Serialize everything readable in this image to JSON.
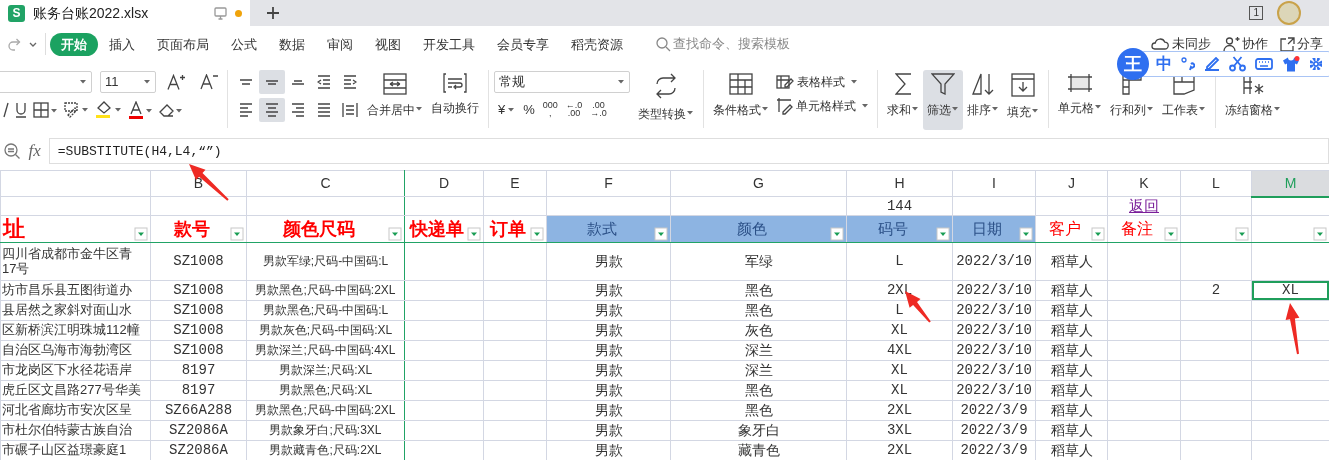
{
  "document_tab": {
    "app_letter": "S",
    "title": "账务台账2022.xlsx",
    "unsaved": true
  },
  "window_count": "1",
  "menu_tabs": [
    {
      "label": "开始",
      "selected": true
    },
    {
      "label": "插入",
      "selected": false
    },
    {
      "label": "页面布局",
      "selected": false
    },
    {
      "label": "公式",
      "selected": false
    },
    {
      "label": "数据",
      "selected": false
    },
    {
      "label": "审阅",
      "selected": false
    },
    {
      "label": "视图",
      "selected": false
    },
    {
      "label": "开发工具",
      "selected": false
    },
    {
      "label": "会员专享",
      "selected": false
    },
    {
      "label": "稻壳资源",
      "selected": false
    }
  ],
  "search": {
    "placeholder": "查找命令、搜索模板"
  },
  "account_actions": [
    "未同步",
    "协作",
    "分享"
  ],
  "ime_toolbar": {
    "logo": "王",
    "mode": "中"
  },
  "ribbon": {
    "font_size": "11",
    "align_buttons": [
      {
        "selected": false
      },
      {
        "selected": true
      },
      {
        "selected": false
      },
      {
        "selected": false
      },
      {
        "selected": false
      },
      {
        "selected": false
      },
      {
        "selected": true
      },
      {
        "selected": false
      },
      {
        "selected": false
      },
      {
        "selected": false
      }
    ],
    "number_format": "常规",
    "number_buttons": [
      {
        "label": "¥",
        "dropdown": true
      },
      {
        "label": "%",
        "dropdown": false
      },
      {
        "label": "000\n,",
        "dropdown": false
      },
      {
        "label": "←.0\n.00",
        "dropdown": false
      },
      {
        "label": ".00\n→.0",
        "dropdown": false
      }
    ],
    "buttons": [
      {
        "label": "合并居中",
        "dropdown": true,
        "selected": false
      },
      {
        "label": "自动换行",
        "dropdown": false,
        "selected": false
      },
      {
        "label": "类型转换",
        "dropdown": true,
        "selected": false
      },
      {
        "label": "条件格式",
        "dropdown": true,
        "selected": false
      },
      {
        "label": "表格样式",
        "dropdown": true,
        "selected": false
      },
      {
        "label": "单元格样式",
        "dropdown": true,
        "selected": false
      },
      {
        "label": "求和",
        "dropdown": true,
        "selected": false
      },
      {
        "label": "筛选",
        "dropdown": true,
        "selected": true
      },
      {
        "label": "排序",
        "dropdown": true,
        "selected": false
      },
      {
        "label": "填充",
        "dropdown": true,
        "selected": false
      },
      {
        "label": "单元格",
        "dropdown": true,
        "selected": false
      },
      {
        "label": "行和列",
        "dropdown": true,
        "selected": false
      },
      {
        "label": "工作表",
        "dropdown": true,
        "selected": false
      },
      {
        "label": "冻结窗格",
        "dropdown": true,
        "selected": false
      }
    ]
  },
  "formula_bar": {
    "label": "fx",
    "formula": "=SUBSTITUTE(H4,L4,“”)"
  },
  "columns": [
    {
      "selected": false
    },
    {
      "letter": "B",
      "selected": false
    },
    {
      "letter": "C",
      "selected": false
    },
    {
      "letter": "D",
      "selected": false
    },
    {
      "letter": "E",
      "selected": false
    },
    {
      "letter": "F",
      "selected": false
    },
    {
      "letter": "G",
      "selected": false
    },
    {
      "letter": "H",
      "selected": false
    },
    {
      "letter": "I",
      "selected": false
    },
    {
      "letter": "J",
      "selected": false
    },
    {
      "letter": "K",
      "selected": false
    },
    {
      "letter": "L",
      "selected": false
    },
    {
      "letter": "M",
      "selected": true
    }
  ],
  "totals_row": [
    {
      "text": "144",
      "kind": "number"
    },
    {
      "text": "返回",
      "kind": "link"
    }
  ],
  "header_row": [
    {
      "text": "址",
      "kind": "title"
    },
    {
      "text": "款号",
      "kind": "title"
    },
    {
      "text": "颜色尺码",
      "kind": "title"
    },
    {
      "text": "快递单",
      "kind": "title"
    },
    {
      "text": "订单",
      "kind": "title"
    },
    {
      "text": "款式",
      "kind": "band"
    },
    {
      "text": "颜色",
      "kind": "band"
    },
    {
      "text": "码号",
      "kind": "band"
    },
    {
      "text": "日期",
      "kind": "band"
    },
    {
      "text": "客户",
      "kind": "label"
    },
    {
      "text": "备注",
      "kind": "label"
    },
    {
      "kind": "blank"
    },
    {
      "kind": "blank"
    }
  ],
  "rows": [
    {
      "selected": false,
      "cells": [
        "四川省成都市金牛区青\n17号",
        "SZ1008",
        "男款军绿;尺码-中国码:L",
        null,
        null,
        "男款",
        "军绿",
        "L",
        "2022/3/10",
        "稻草人",
        null,
        null,
        null
      ]
    },
    {
      "selected": true,
      "cells": [
        "坊市昌乐县五图街道办",
        "SZ1008",
        "男款黑色;尺码-中国码:2XL",
        null,
        null,
        "男款",
        "黑色",
        "2XL",
        "2022/3/10",
        "稻草人",
        null,
        "2",
        "XL"
      ]
    },
    {
      "selected": false,
      "cells": [
        "县居然之家斜对面山水",
        "SZ1008",
        "男款黑色;尺码-中国码:L",
        null,
        null,
        "男款",
        "黑色",
        "L",
        "2022/3/10",
        "稻草人",
        null,
        null,
        null
      ]
    },
    {
      "selected": false,
      "cells": [
        "区新桥滨江明珠城112幢",
        "SZ1008",
        "男款灰色;尺码-中国码:XL",
        null,
        null,
        "男款",
        "灰色",
        "XL",
        "2022/3/10",
        "稻草人",
        null,
        null,
        null
      ]
    },
    {
      "selected": false,
      "cells": [
        "自治区乌海市海勃湾区",
        "SZ1008",
        "男款深兰;尺码-中国码:4XL",
        null,
        null,
        "男款",
        "深兰",
        "4XL",
        "2022/3/10",
        "稻草人",
        null,
        null,
        null
      ]
    },
    {
      "selected": false,
      "cells": [
        "市龙岗区下水径花语岸",
        "8197",
        "男款深兰;尺码:XL",
        null,
        null,
        "男款",
        "深兰",
        "XL",
        "2022/3/10",
        "稻草人",
        null,
        null,
        null
      ]
    },
    {
      "selected": false,
      "cells": [
        "虎丘区文昌路277号华美",
        "8197",
        "男款黑色;尺码:XL",
        null,
        null,
        "男款",
        "黑色",
        "XL",
        "2022/3/10",
        "稻草人",
        null,
        null,
        null
      ]
    },
    {
      "selected": false,
      "cells": [
        "河北省廊坊市安次区呈",
        "SZ66A288",
        "男款黑色;尺码-中国码:2XL",
        null,
        null,
        "男款",
        "黑色",
        "2XL",
        "2022/3/9",
        "稻草人",
        null,
        null,
        null
      ]
    },
    {
      "selected": false,
      "cells": [
        "市杜尔伯特蒙古族自治",
        "SZ2086A",
        "男款象牙白;尺码:3XL",
        null,
        null,
        "男款",
        "象牙白",
        "3XL",
        "2022/3/9",
        "稻草人",
        null,
        null,
        null
      ]
    },
    {
      "selected": false,
      "cells": [
        "市碾子山区益璟豪庭1",
        "SZ2086A",
        "男款藏青色;尺码:2XL",
        null,
        null,
        "男款",
        "藏青色",
        "2XL",
        "2022/3/9",
        "稻草人",
        null,
        null,
        null
      ]
    }
  ]
}
